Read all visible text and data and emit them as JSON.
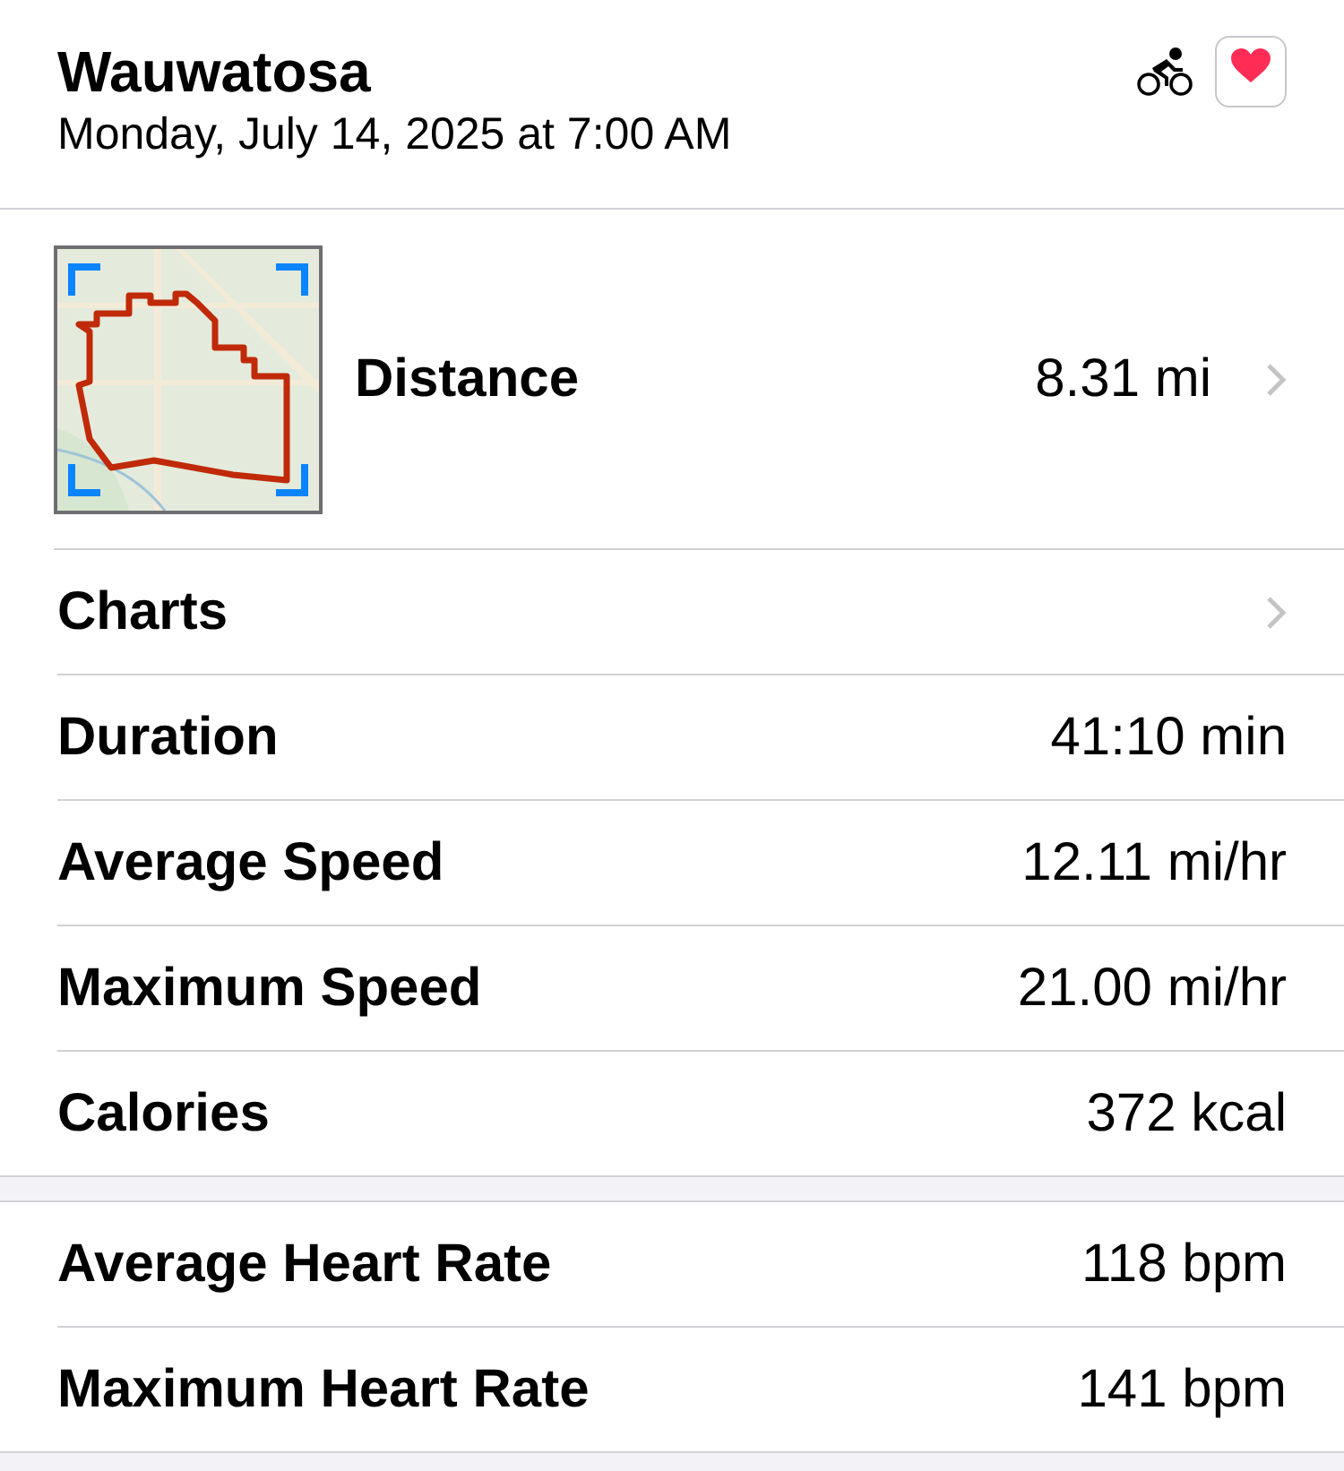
{
  "header": {
    "title": "Wauwatosa",
    "date": "Monday, July 14, 2025 at 7:00 AM"
  },
  "route": {
    "kind": "picture",
    "label": "Distance",
    "value": "8.31 mi"
  },
  "sections": [
    {
      "rows": [
        {
          "kind": "link",
          "label": "Charts"
        },
        {
          "kind": "value",
          "label": "Duration",
          "value": "41:10 min"
        },
        {
          "kind": "value",
          "label": "Average Speed",
          "value": "12.11 mi/hr"
        },
        {
          "kind": "value",
          "label": "Maximum Speed",
          "value": "21.00 mi/hr"
        },
        {
          "kind": "value",
          "label": "Calories",
          "value": "372 kcal"
        }
      ]
    },
    {
      "rows": [
        {
          "kind": "value",
          "label": "Average Heart Rate",
          "value": "118 bpm"
        },
        {
          "kind": "value",
          "label": "Maximum Heart Rate",
          "value": "141 bpm"
        }
      ]
    }
  ]
}
